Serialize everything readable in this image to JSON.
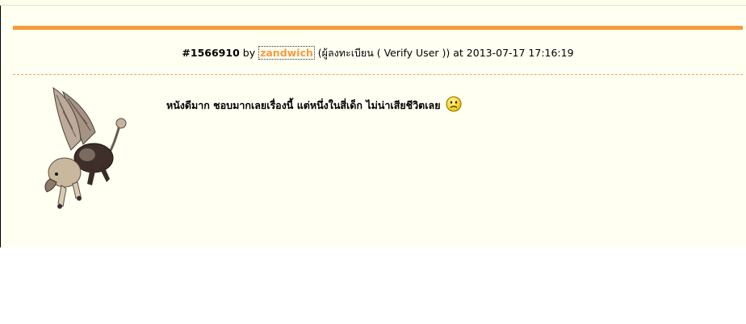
{
  "post": {
    "id_label": "#1566910",
    "by_label": "by",
    "username": "zandwich",
    "user_role": "(ผู้ลงทะเบียน ( Verify User ))",
    "at_label": "at",
    "timestamp": "2013-07-17 17:16:19"
  },
  "avatar": {
    "icon": "griffin-avatar"
  },
  "message": {
    "text": "หนังดีมาก ชอบมากเลยเรื่องนี้   แต่หนึ่งในสี่เด็ก ไม่น่าเสียชีวิตเลย",
    "emoticon": "sad-face-icon"
  },
  "colors": {
    "accent_orange": "#f79b3a",
    "background": "#fffff2"
  }
}
